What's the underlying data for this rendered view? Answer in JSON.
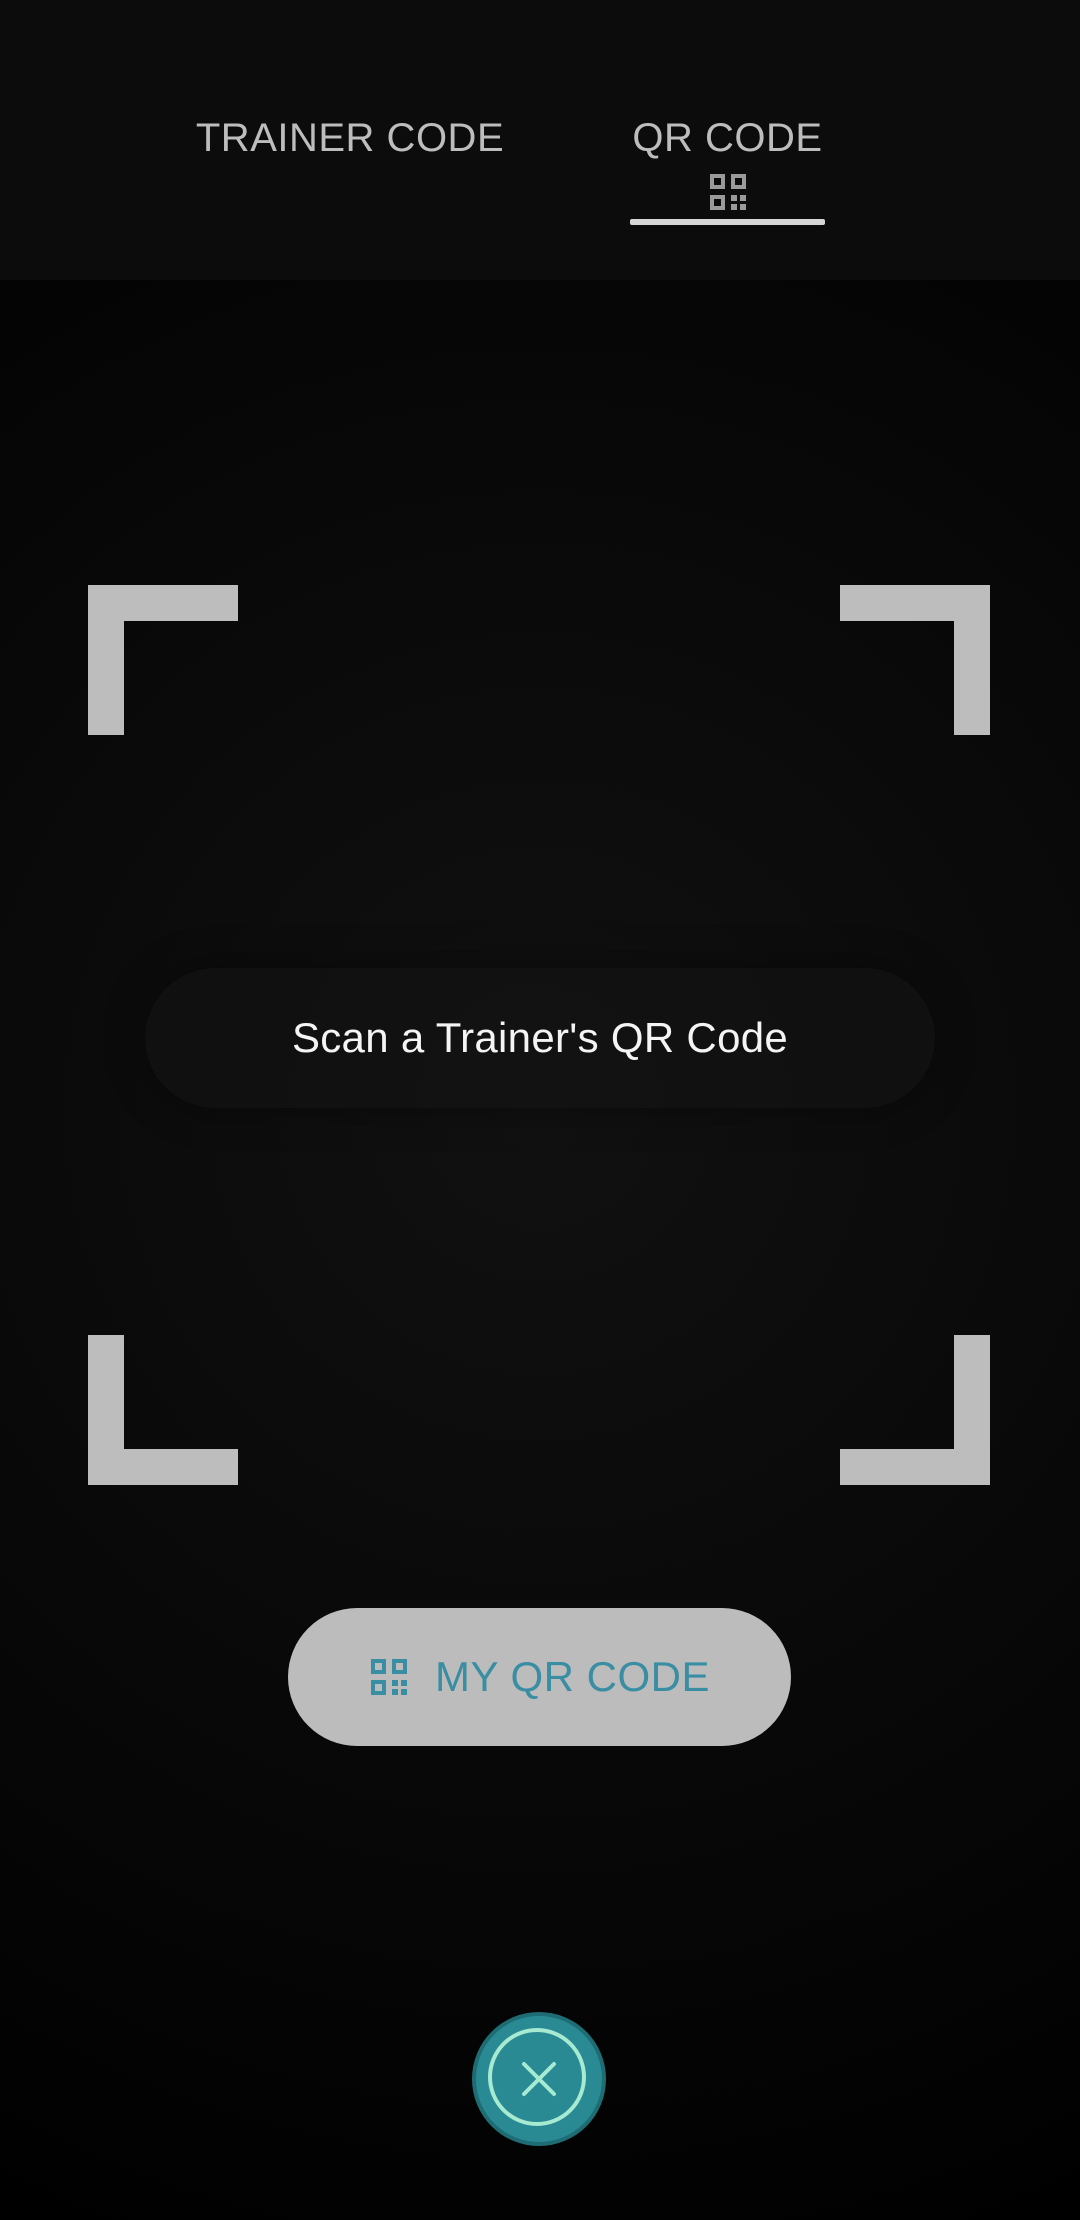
{
  "tabs": [
    {
      "label": "TRAINER CODE",
      "active": false
    },
    {
      "label": "QR CODE",
      "active": true,
      "icon": "qr-code-icon"
    }
  ],
  "scanner": {
    "hint": "Scan a Trainer's QR Code"
  },
  "my_qr_button": {
    "label": "MY QR CODE",
    "icon": "qr-code-icon"
  },
  "close_button": {
    "icon": "close-icon"
  },
  "colors": {
    "accent": "#2a8a93",
    "accent_text": "#3a8ea3",
    "frame": "#bdbdbd"
  }
}
